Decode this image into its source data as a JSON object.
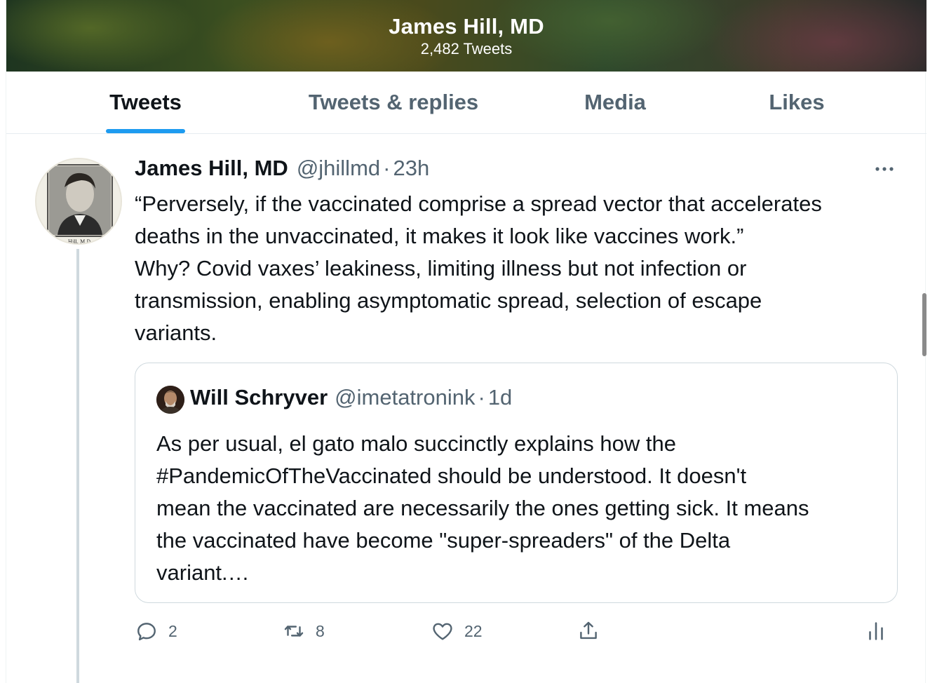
{
  "profile_header": {
    "name": "James Hill, MD",
    "tweet_count": "2,482 Tweets"
  },
  "tabs": [
    {
      "label": "Tweets",
      "active": true
    },
    {
      "label": "Tweets & replies",
      "active": false
    },
    {
      "label": "Media",
      "active": false
    },
    {
      "label": "Likes",
      "active": false
    }
  ],
  "tweet": {
    "author_name": "James Hill, MD",
    "author_handle": "@jhillmd",
    "separator": "·",
    "time": "23h",
    "avatar_caption": "Hill, M.D.",
    "text_lines": [
      "“Perversely, if the vaccinated comprise a spread vector that accelerates",
      "deaths in the unvaccinated, it makes it look like vaccines work.”",
      "Why? Covid vaxes’ leakiness, limiting illness but not infection or",
      "transmission, enabling asymptomatic spread, selection of escape",
      "variants."
    ],
    "quote": {
      "author_name": "Will Schryver",
      "author_handle": "@imetatronink",
      "separator": "·",
      "time": "1d",
      "text_lines": [
        "As per usual, el gato malo succinctly explains how the",
        "#PandemicOfTheVaccinated should be understood. It doesn't",
        "mean the vaccinated are necessarily the ones getting sick. It means",
        "the vaccinated have become \"super-spreaders\" of the Delta",
        "variant.…"
      ]
    },
    "actions": {
      "replies": "2",
      "retweets": "8",
      "likes": "22"
    }
  },
  "icons": {
    "more": "more-dots-icon",
    "reply": "reply-icon",
    "retweet": "retweet-icon",
    "like": "heart-icon",
    "share": "share-icon",
    "analytics": "analytics-icon"
  },
  "colors": {
    "accent": "#1d9bf0",
    "secondary_text": "#536471",
    "primary_text": "#0f1419",
    "border": "#cfd9de"
  }
}
